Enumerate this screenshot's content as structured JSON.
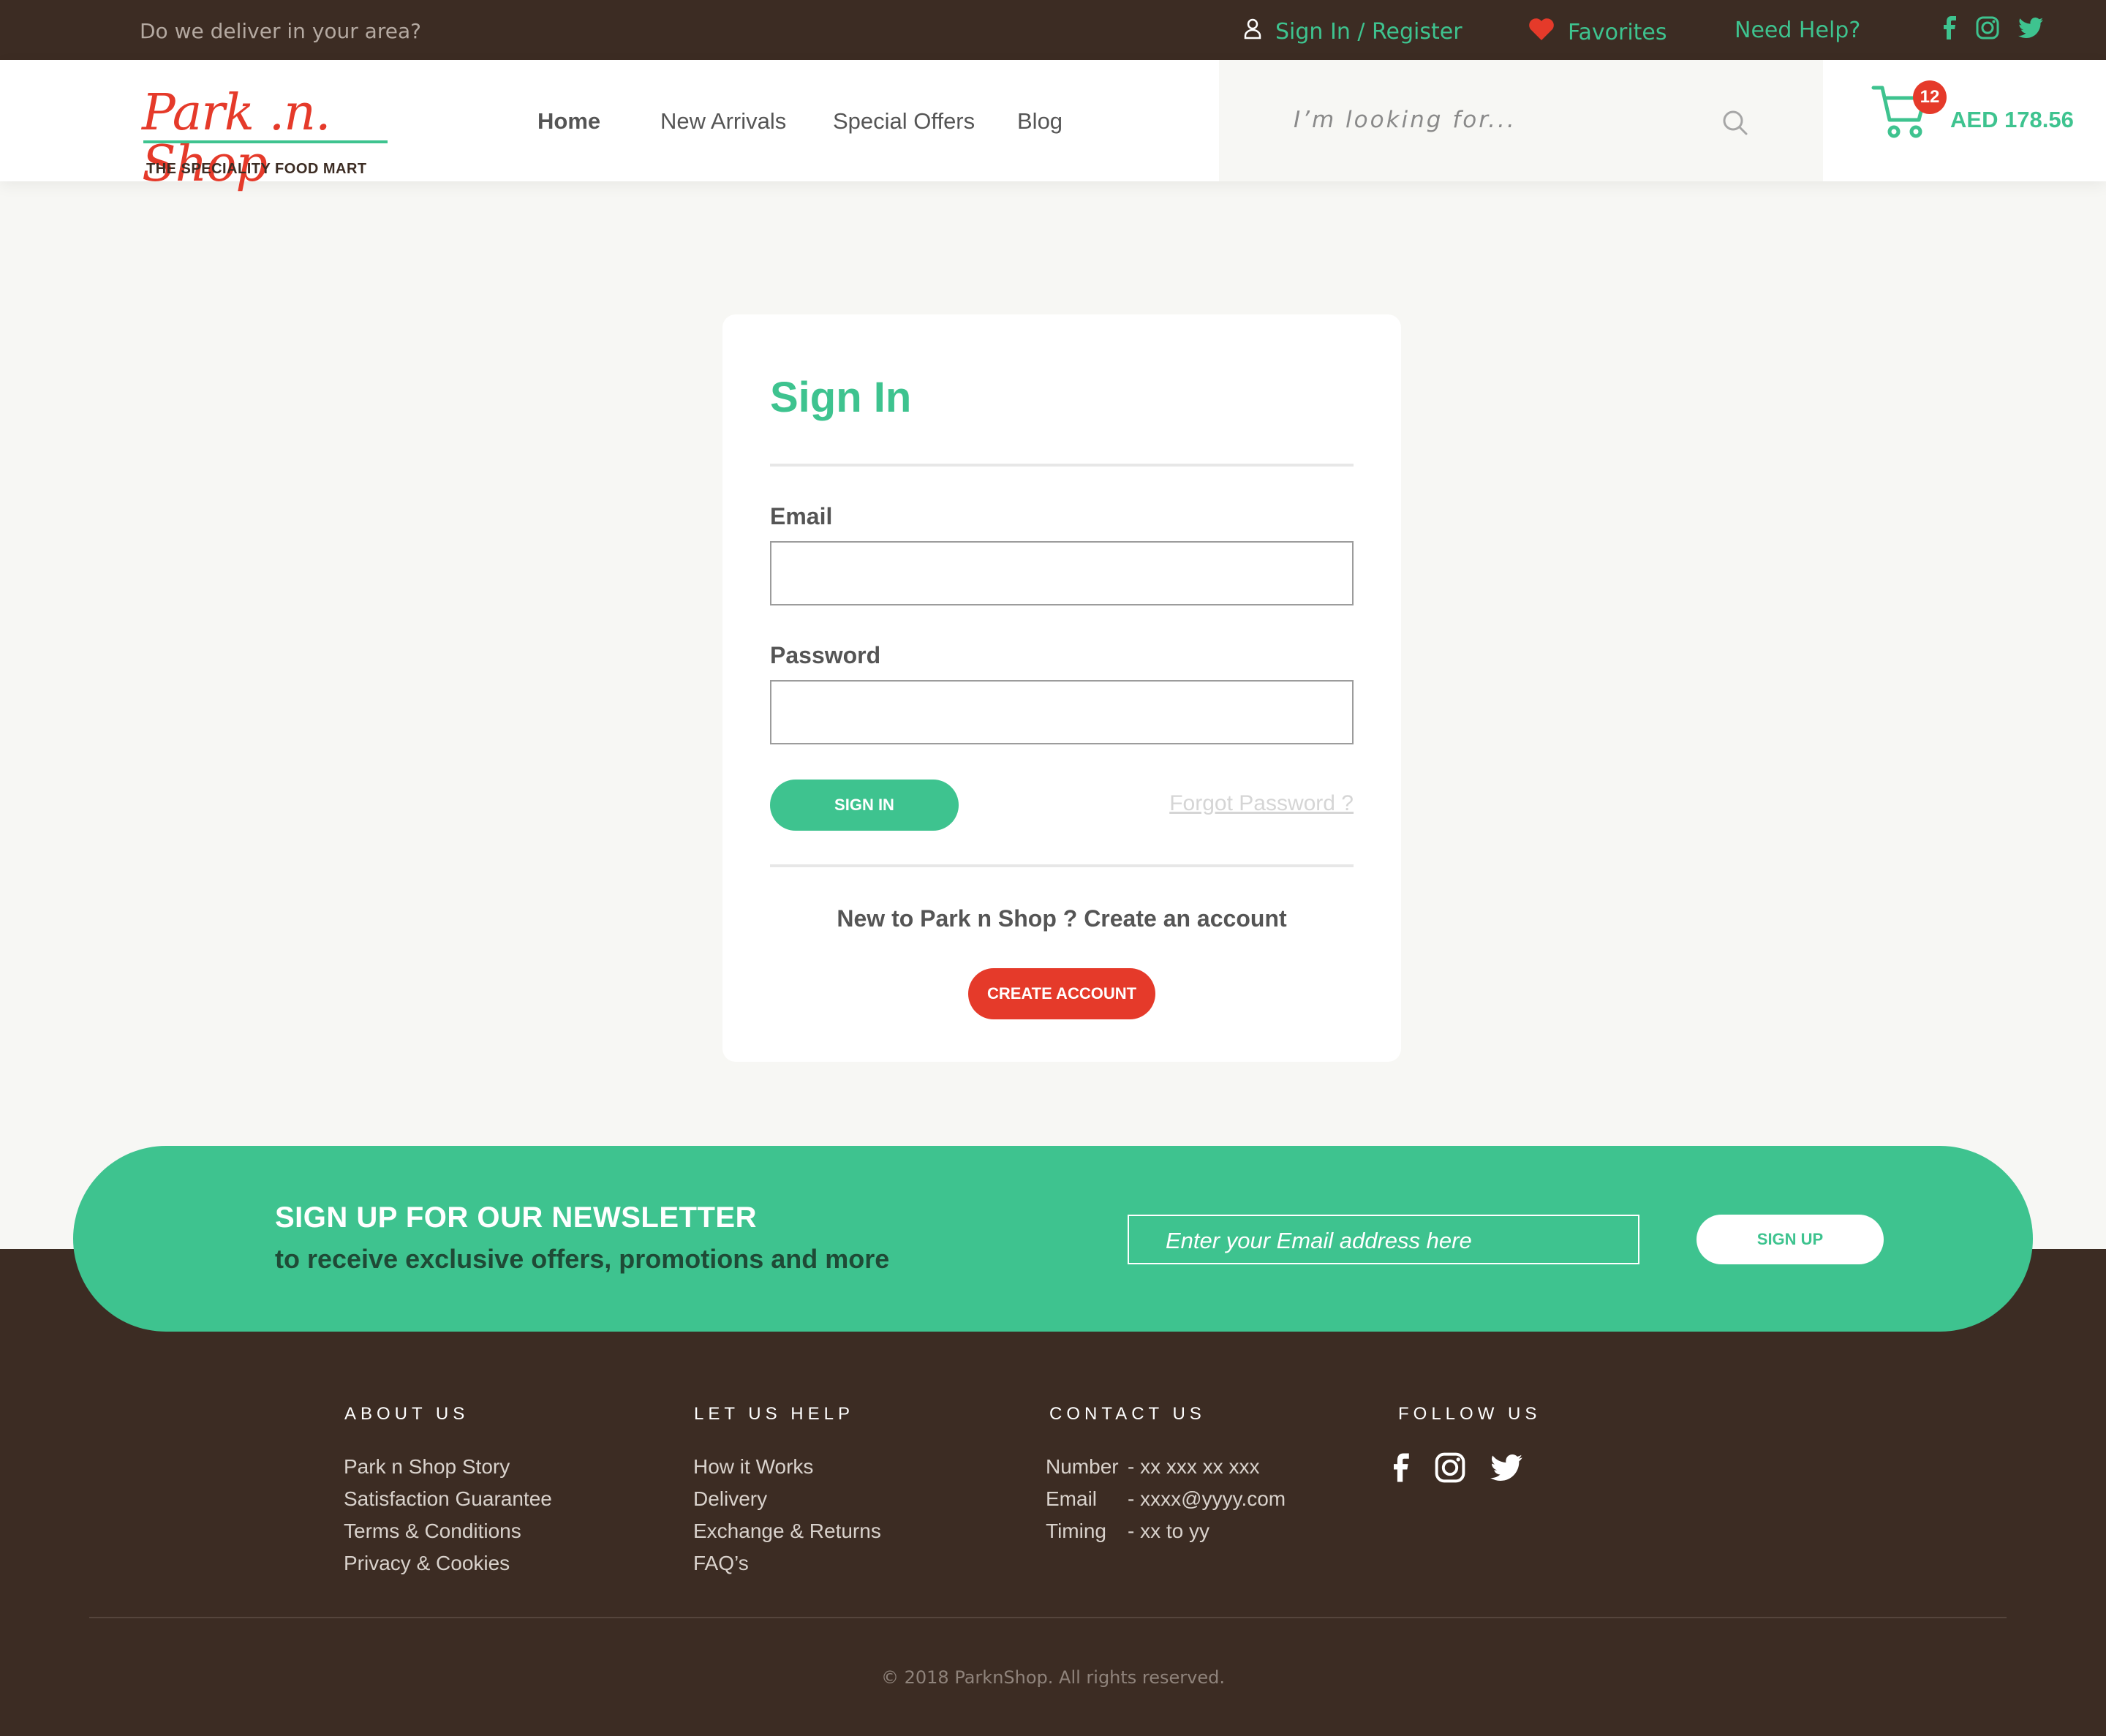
{
  "topbar": {
    "deliver_text": "Do we deliver in your area?",
    "signin_label": "Sign In / Register",
    "favorites_label": "Favorites",
    "help_label": "Need Help?",
    "social": [
      "facebook-icon",
      "instagram-icon",
      "twitter-icon"
    ]
  },
  "header": {
    "logo_text": "Park .n. Shop",
    "logo_tagline": "THE SPECIALITY FOOD MART",
    "nav": [
      "Home",
      "New Arrivals",
      "Special Offers",
      "Blog"
    ],
    "search_placeholder": "I’m looking for...",
    "cart_count": "12",
    "cart_amount": "AED 178.56"
  },
  "signin": {
    "title": "Sign In",
    "email_label": "Email",
    "password_label": "Password",
    "signin_button": "SIGN IN",
    "forgot_link": "Forgot Password ?",
    "new_text": "New to Park n Shop ? Create an account",
    "create_button": "CREATE ACCOUNT"
  },
  "newsletter": {
    "heading": "SIGN UP FOR OUR NEWSLETTER",
    "subheading": "to receive exclusive offers, promotions and more",
    "placeholder": "Enter your Email address here",
    "button": "SIGN UP"
  },
  "footer": {
    "about": {
      "heading": "ABOUT US",
      "items": [
        "Park n Shop Story",
        "Satisfaction Guarantee",
        "Terms & Conditions",
        "Privacy & Cookies"
      ]
    },
    "help": {
      "heading": "LET US HELP",
      "items": [
        "How it Works",
        "Delivery",
        "Exchange & Returns",
        "FAQ’s"
      ]
    },
    "contact": {
      "heading": "CONTACT US",
      "rows": [
        {
          "key": "Number",
          "value": "- xx xxx xx xxx"
        },
        {
          "key": "Email",
          "value": "- xxxx@yyyy.com"
        },
        {
          "key": "Timing",
          "value": "- xx to yy"
        }
      ]
    },
    "follow": {
      "heading": "FOLLOW US"
    },
    "copyright": "© 2018 ParknShop. All rights reserved."
  },
  "colors": {
    "brand_green": "#3ec38f",
    "brand_red": "#e53a2a",
    "dark_brown": "#3c2c23",
    "page_bg": "#f7f7f4"
  }
}
